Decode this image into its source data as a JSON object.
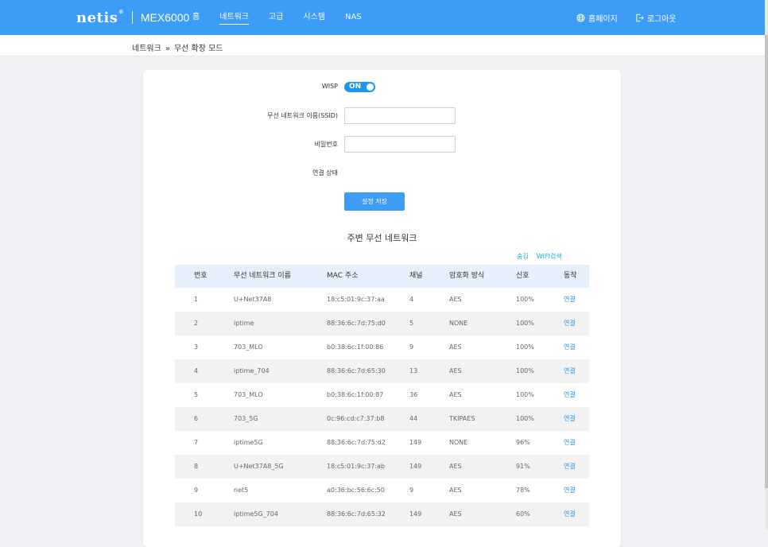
{
  "header": {
    "brand": "netis",
    "brand_mark": "®",
    "model": "MEX6000",
    "nav": [
      {
        "label": "홈"
      },
      {
        "label": "네트워크"
      },
      {
        "label": "고급"
      },
      {
        "label": "시스템"
      },
      {
        "label": "NAS"
      }
    ],
    "active_nav": "네트워크",
    "homepage_label": "홈페이지",
    "logout_label": "로그아웃"
  },
  "breadcrumb": {
    "parent": "네트워크",
    "separator": "»",
    "current": "무선 확장 모드"
  },
  "form": {
    "wisp_label": "WISP",
    "wisp_toggle": "ON",
    "ssid_label": "무선 네트워크 이름(SSID)",
    "ssid_value": "",
    "password_label": "비밀번호",
    "password_value": "",
    "status_label": "연결 상태",
    "status_value": "",
    "save_label": "설정 저장"
  },
  "nearby": {
    "title": "주변 무선 네트워크",
    "hide_label": "숨김",
    "scan_label": "WIFI검색",
    "columns": [
      "번호",
      "무선 네트워크 이름",
      "MAC 주소",
      "채널",
      "암호화 방식",
      "신호",
      "동작"
    ],
    "rows": [
      {
        "idx": "1",
        "ssid": "U+Net37A8",
        "mac": "18:c5:01:9c:37:aa",
        "channel": "4",
        "enc": "AES",
        "signal": "100%",
        "action": "연결"
      },
      {
        "idx": "2",
        "ssid": "iptime",
        "mac": "88:36:6c:7d:75:d0",
        "channel": "5",
        "enc": "NONE",
        "signal": "100%",
        "action": "연결"
      },
      {
        "idx": "3",
        "ssid": "703_MLO",
        "mac": "b0:38:6c:1f:00:86",
        "channel": "9",
        "enc": "AES",
        "signal": "100%",
        "action": "연결"
      },
      {
        "idx": "4",
        "ssid": "iptime_704",
        "mac": "88:36:6c:7d:65:30",
        "channel": "13",
        "enc": "AES",
        "signal": "100%",
        "action": "연결"
      },
      {
        "idx": "5",
        "ssid": "703_MLO",
        "mac": "b0:38:6c:1f:00:87",
        "channel": "36",
        "enc": "AES",
        "signal": "100%",
        "action": "연결"
      },
      {
        "idx": "6",
        "ssid": "703_5G",
        "mac": "0c:96:cd:c7:37:b8",
        "channel": "44",
        "enc": "TKIPAES",
        "signal": "100%",
        "action": "연결"
      },
      {
        "idx": "7",
        "ssid": "iptime5G",
        "mac": "88:36:6c:7d:75:d2",
        "channel": "149",
        "enc": "NONE",
        "signal": "96%",
        "action": "연결"
      },
      {
        "idx": "8",
        "ssid": "U+Net37A8_5G",
        "mac": "18:c5:01:9c:37:ab",
        "channel": "149",
        "enc": "AES",
        "signal": "91%",
        "action": "연결"
      },
      {
        "idx": "9",
        "ssid": "net5",
        "mac": "a0:36:bc:56:6c:50",
        "channel": "9",
        "enc": "AES",
        "signal": "78%",
        "action": "연결"
      },
      {
        "idx": "10",
        "ssid": "iptime5G_704",
        "mac": "88:36:6c:7d:65:32",
        "channel": "149",
        "enc": "AES",
        "signal": "60%",
        "action": "연결"
      }
    ]
  },
  "colors": {
    "header": "#3c9cf6",
    "accent": "#1d96f3",
    "link": "#1aaed1",
    "table_head": "#e6f0fb",
    "page_bg": "#f0f2f5"
  },
  "icons": {
    "homepage": "globe-icon",
    "logout": "logout-icon",
    "toggle_knob": "circle-knob-icon"
  }
}
